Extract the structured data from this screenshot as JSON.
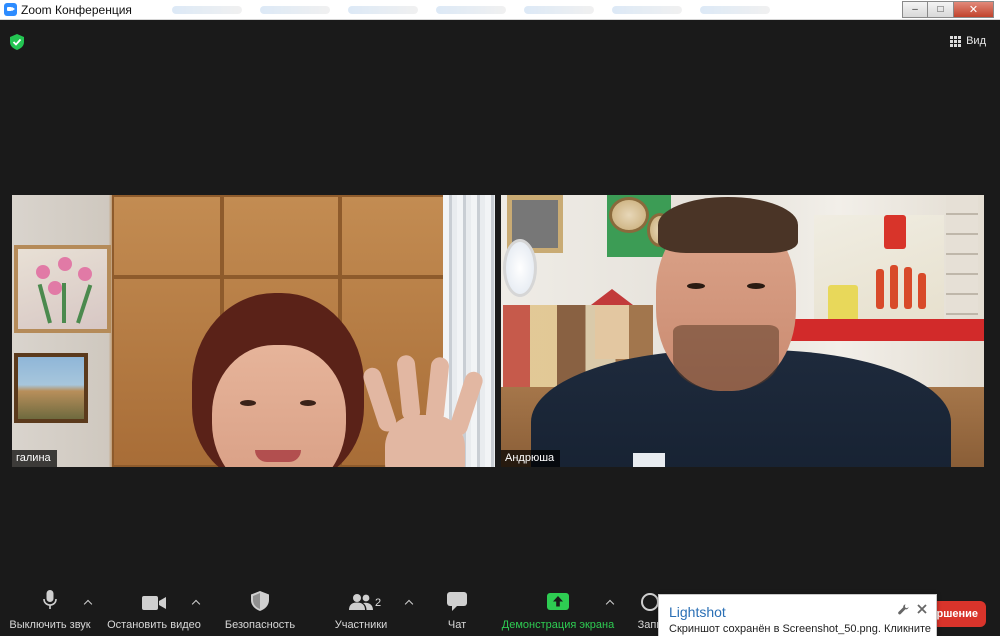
{
  "window": {
    "title": "Zoom Конференция",
    "minimize_glyph": "–",
    "maximize_glyph": "□",
    "close_glyph": "✕"
  },
  "header": {
    "view_label": "Вид"
  },
  "participants": [
    {
      "name": "галина"
    },
    {
      "name": "Андрюша"
    }
  ],
  "toolbar": {
    "mute_label": "Выключить звук",
    "video_label": "Остановить видео",
    "security_label": "Безопасность",
    "participants_label": "Участники",
    "participants_count": "2",
    "chat_label": "Чат",
    "share_label": "Демонстрация экрана",
    "record_label_partial": "Запи",
    "end_label_partial": "ршение"
  },
  "lightshot": {
    "title": "Lightshot",
    "message": "Скриншот сохранён в Screenshot_50.png. Кликните"
  },
  "colors": {
    "accent_green": "#2ecc52",
    "end_red": "#d9342b",
    "lightshot_blue": "#2a6fb5"
  },
  "icons": {
    "shield": "shield-check-icon",
    "view": "grid-icon",
    "mic": "microphone-icon",
    "video": "video-camera-icon",
    "security": "shield-icon",
    "participants": "people-icon",
    "chat": "chat-bubble-icon",
    "share": "share-arrow-icon",
    "lightshot_settings": "wrench-icon",
    "lightshot_close": "close-icon"
  }
}
